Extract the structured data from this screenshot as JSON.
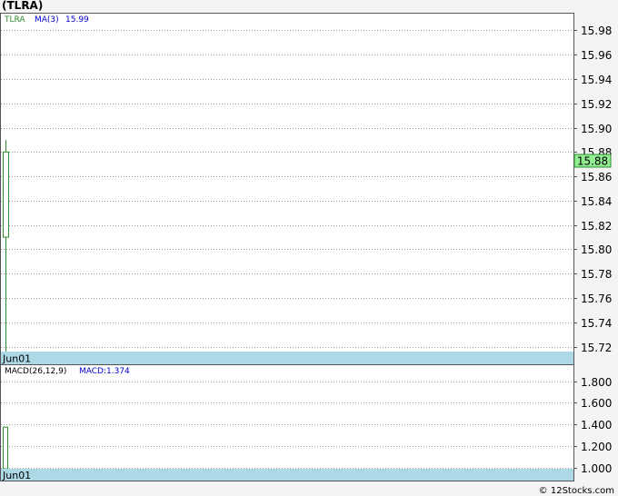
{
  "title": "(TLRA)",
  "credit": "© 12Stocks.com",
  "colors": {
    "up": "#2e8b2e",
    "grid": "#999999",
    "date_band": "#add8e6",
    "price_tag": "#90ee90",
    "ma_label": "#0000cc",
    "ticker_label": "#2e8b2e"
  },
  "chart_data": [
    {
      "type": "candlestick",
      "legend": {
        "ticker": "TLRA",
        "ma_label": "MA(3)",
        "ma_value": "15.99"
      },
      "ylim": [
        15.71,
        15.99
      ],
      "yticks": [
        {
          "value": 15.98,
          "label": "15.98"
        },
        {
          "value": 15.96,
          "label": "15.96"
        },
        {
          "value": 15.94,
          "label": "15.94"
        },
        {
          "value": 15.92,
          "label": "15.92"
        },
        {
          "value": 15.9,
          "label": "15.90"
        },
        {
          "value": 15.88,
          "label": "15.88"
        },
        {
          "value": 15.86,
          "label": "15.86"
        },
        {
          "value": 15.84,
          "label": "15.84"
        },
        {
          "value": 15.82,
          "label": "15.82"
        },
        {
          "value": 15.8,
          "label": "15.80"
        },
        {
          "value": 15.78,
          "label": "15.78"
        },
        {
          "value": 15.76,
          "label": "15.76"
        },
        {
          "value": 15.74,
          "label": "15.74"
        },
        {
          "value": 15.72,
          "label": "15.72"
        }
      ],
      "date_label": "Jun01",
      "last_price": "15.88",
      "candles": [
        {
          "date": "Jun01",
          "open": 15.81,
          "high": 15.89,
          "low": 15.71,
          "close": 15.88
        }
      ]
    },
    {
      "type": "bar",
      "legend": {
        "indicator": "MACD(26,12,9)",
        "value_label": "MACD:1.374"
      },
      "ylim": [
        0.87,
        1.94
      ],
      "yticks": [
        {
          "value": 1.8,
          "label": "1.800"
        },
        {
          "value": 1.6,
          "label": "1.600"
        },
        {
          "value": 1.4,
          "label": "1.400"
        },
        {
          "value": 1.2,
          "label": "1.200"
        },
        {
          "value": 1.0,
          "label": "1.000"
        }
      ],
      "date_label": "Jun01",
      "bars": [
        {
          "date": "Jun01",
          "value": 1.374
        }
      ]
    }
  ]
}
